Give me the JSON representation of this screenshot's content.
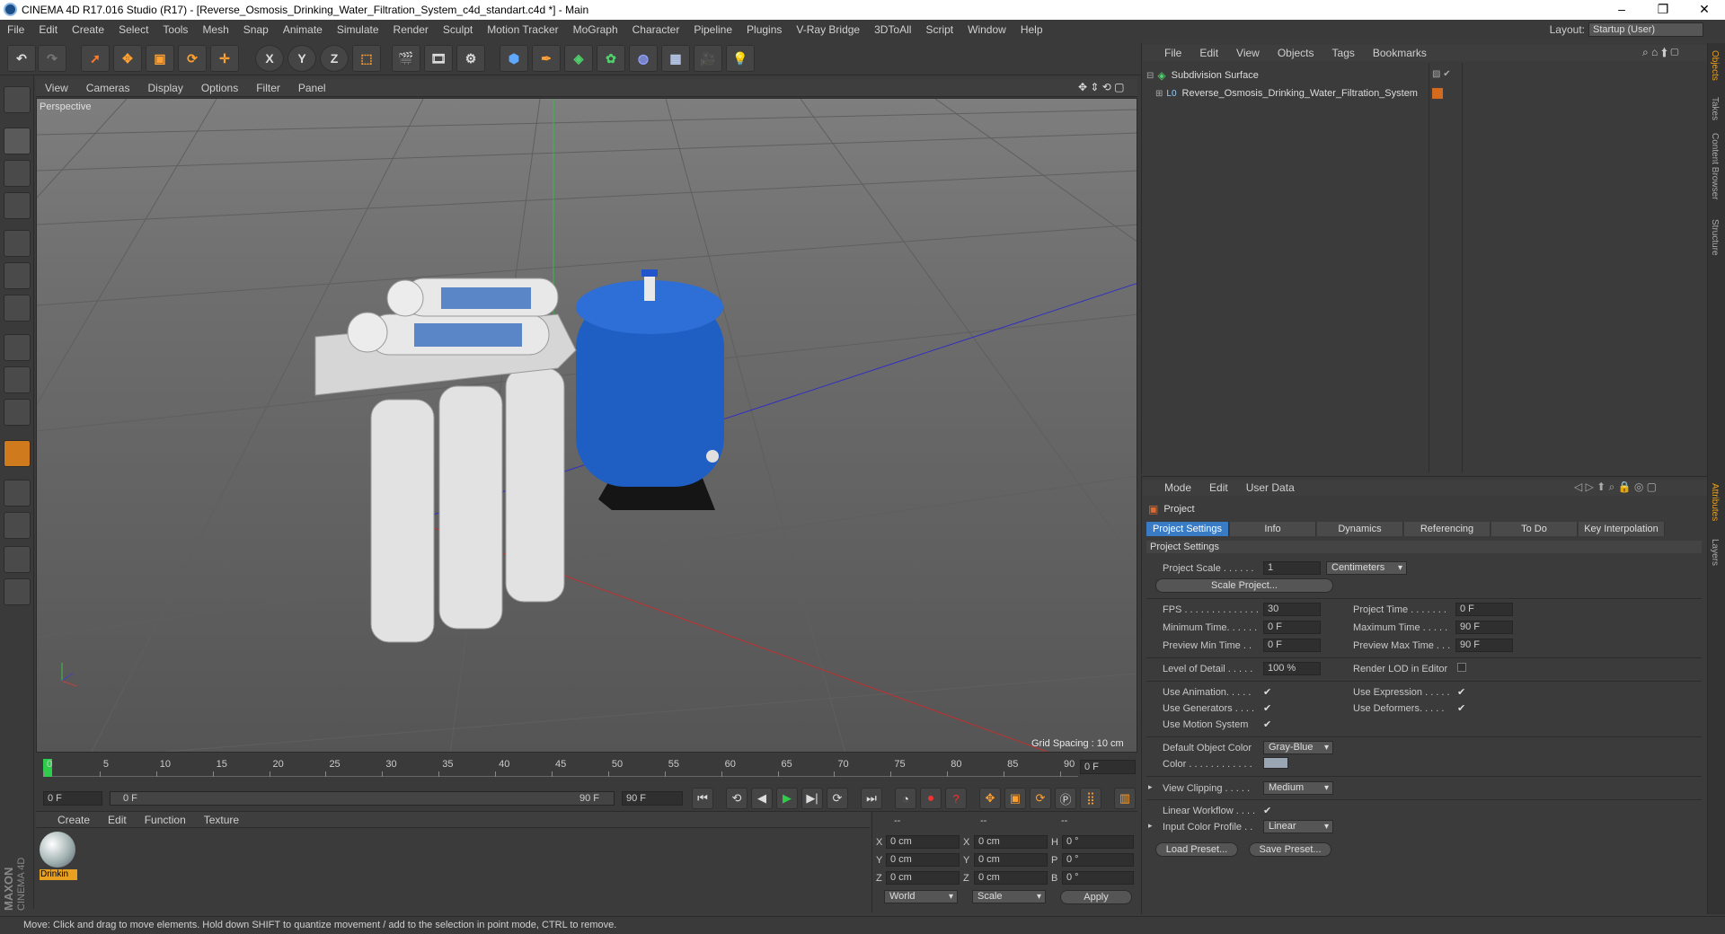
{
  "window": {
    "title": "CINEMA 4D R17.016 Studio (R17) - [Reverse_Osmosis_Drinking_Water_Filtration_System_c4d_standart.c4d *] - Main",
    "min": "–",
    "max": "❐",
    "close": "✕"
  },
  "menu": [
    "File",
    "Edit",
    "Create",
    "Select",
    "Tools",
    "Mesh",
    "Snap",
    "Animate",
    "Simulate",
    "Render",
    "Sculpt",
    "Motion Tracker",
    "MoGraph",
    "Character",
    "Pipeline",
    "Plugins",
    "V-Ray Bridge",
    "3DToAll",
    "Script",
    "Window",
    "Help"
  ],
  "layout": {
    "label": "Layout:",
    "value": "Startup (User)"
  },
  "toolbar": {
    "x": "X",
    "y": "Y",
    "z": "Z"
  },
  "viewport": {
    "menu": [
      "View",
      "Cameras",
      "Display",
      "Options",
      "Filter",
      "Panel"
    ],
    "label": "Perspective",
    "grid_spacing": "Grid Spacing : 10 cm"
  },
  "timeline": {
    "ticks": [
      "0",
      "5",
      "10",
      "15",
      "20",
      "25",
      "30",
      "35",
      "40",
      "45",
      "50",
      "55",
      "60",
      "65",
      "70",
      "75",
      "80",
      "85",
      "90"
    ],
    "current": "0 F",
    "start": "0 F",
    "slider_start": "0 F",
    "slider_end": "90 F",
    "end": "90 F"
  },
  "material_manager": {
    "menu": [
      "Create",
      "Edit",
      "Function",
      "Texture"
    ],
    "material_name": "Drinkin"
  },
  "coords": {
    "headers": [
      "--",
      "--",
      "--"
    ],
    "rows": [
      {
        "a": "X",
        "v1": "0 cm",
        "b": "X",
        "v2": "0 cm",
        "c": "H",
        "v3": "0 °"
      },
      {
        "a": "Y",
        "v1": "0 cm",
        "b": "Y",
        "v2": "0 cm",
        "c": "P",
        "v3": "0 °"
      },
      {
        "a": "Z",
        "v1": "0 cm",
        "b": "Z",
        "v2": "0 cm",
        "c": "B",
        "v3": "0 °"
      }
    ],
    "world": "World",
    "scale": "Scale",
    "apply": "Apply"
  },
  "object_manager": {
    "menu": [
      "File",
      "Edit",
      "View",
      "Objects",
      "Tags",
      "Bookmarks"
    ],
    "objects": [
      {
        "name": "Subdivision Surface",
        "tag_color": ""
      },
      {
        "name": "Reverse_Osmosis_Drinking_Water_Filtration_System",
        "tag_color": "#d46a1e"
      }
    ]
  },
  "side_tabs": [
    "Objects",
    "Takes",
    "Content Browser",
    "Structure"
  ],
  "side_tabs_lower": [
    "Attributes",
    "Layers"
  ],
  "attributes": {
    "menu": [
      "Mode",
      "Edit",
      "User Data"
    ],
    "object": "Project",
    "tabs": [
      "Project Settings",
      "Info",
      "Dynamics",
      "Referencing",
      "To Do",
      "Key Interpolation"
    ],
    "section": "Project Settings",
    "project_scale_label": "Project Scale . . . . . .",
    "project_scale_value": "1",
    "project_scale_unit": "Centimeters",
    "scale_project_btn": "Scale Project...",
    "fps_label": "FPS . . . . . . . . . . . . . .",
    "fps_value": "30",
    "project_time_label": "Project Time . . . . . . .",
    "project_time_value": "0 F",
    "min_time_label": "Minimum Time. . . . . .",
    "min_time_value": "0 F",
    "max_time_label": "Maximum Time . . . . .",
    "max_time_value": "90 F",
    "prev_min_label": "Preview Min Time . .",
    "prev_min_value": "0 F",
    "prev_max_label": "Preview Max Time . . .",
    "prev_max_value": "90 F",
    "lod_label": "Level of Detail . . . . .",
    "lod_value": "100 %",
    "render_lod_label": "Render LOD in Editor",
    "use_animation_label": "Use Animation. . . . .",
    "use_expression_label": "Use Expression . . . . .",
    "use_generators_label": "Use Generators . . . .",
    "use_deformers_label": "Use Deformers. . . . .",
    "use_motion_label": "Use Motion System",
    "default_color_label": "Default Object Color",
    "default_color_value": "Gray-Blue",
    "color_label": "Color . . . . . . . . . . . .",
    "view_clipping_label": "View Clipping . . . . .",
    "view_clipping_value": "Medium",
    "linear_workflow_label": "Linear Workflow . . . .",
    "input_profile_label": "Input Color Profile . .",
    "input_profile_value": "Linear",
    "load_preset": "Load Preset...",
    "save_preset": "Save Preset...",
    "check": "✔"
  },
  "status": "Move: Click and drag to move elements. Hold down SHIFT to quantize movement / add to the selection in point mode, CTRL to remove.",
  "brand": {
    "maxon": "MAXON",
    "product": "CINEMA 4D"
  },
  "colors": {
    "accent": "#3a7bc6",
    "tank": "#1f5fc4",
    "swatch": "#9aa6b4"
  }
}
